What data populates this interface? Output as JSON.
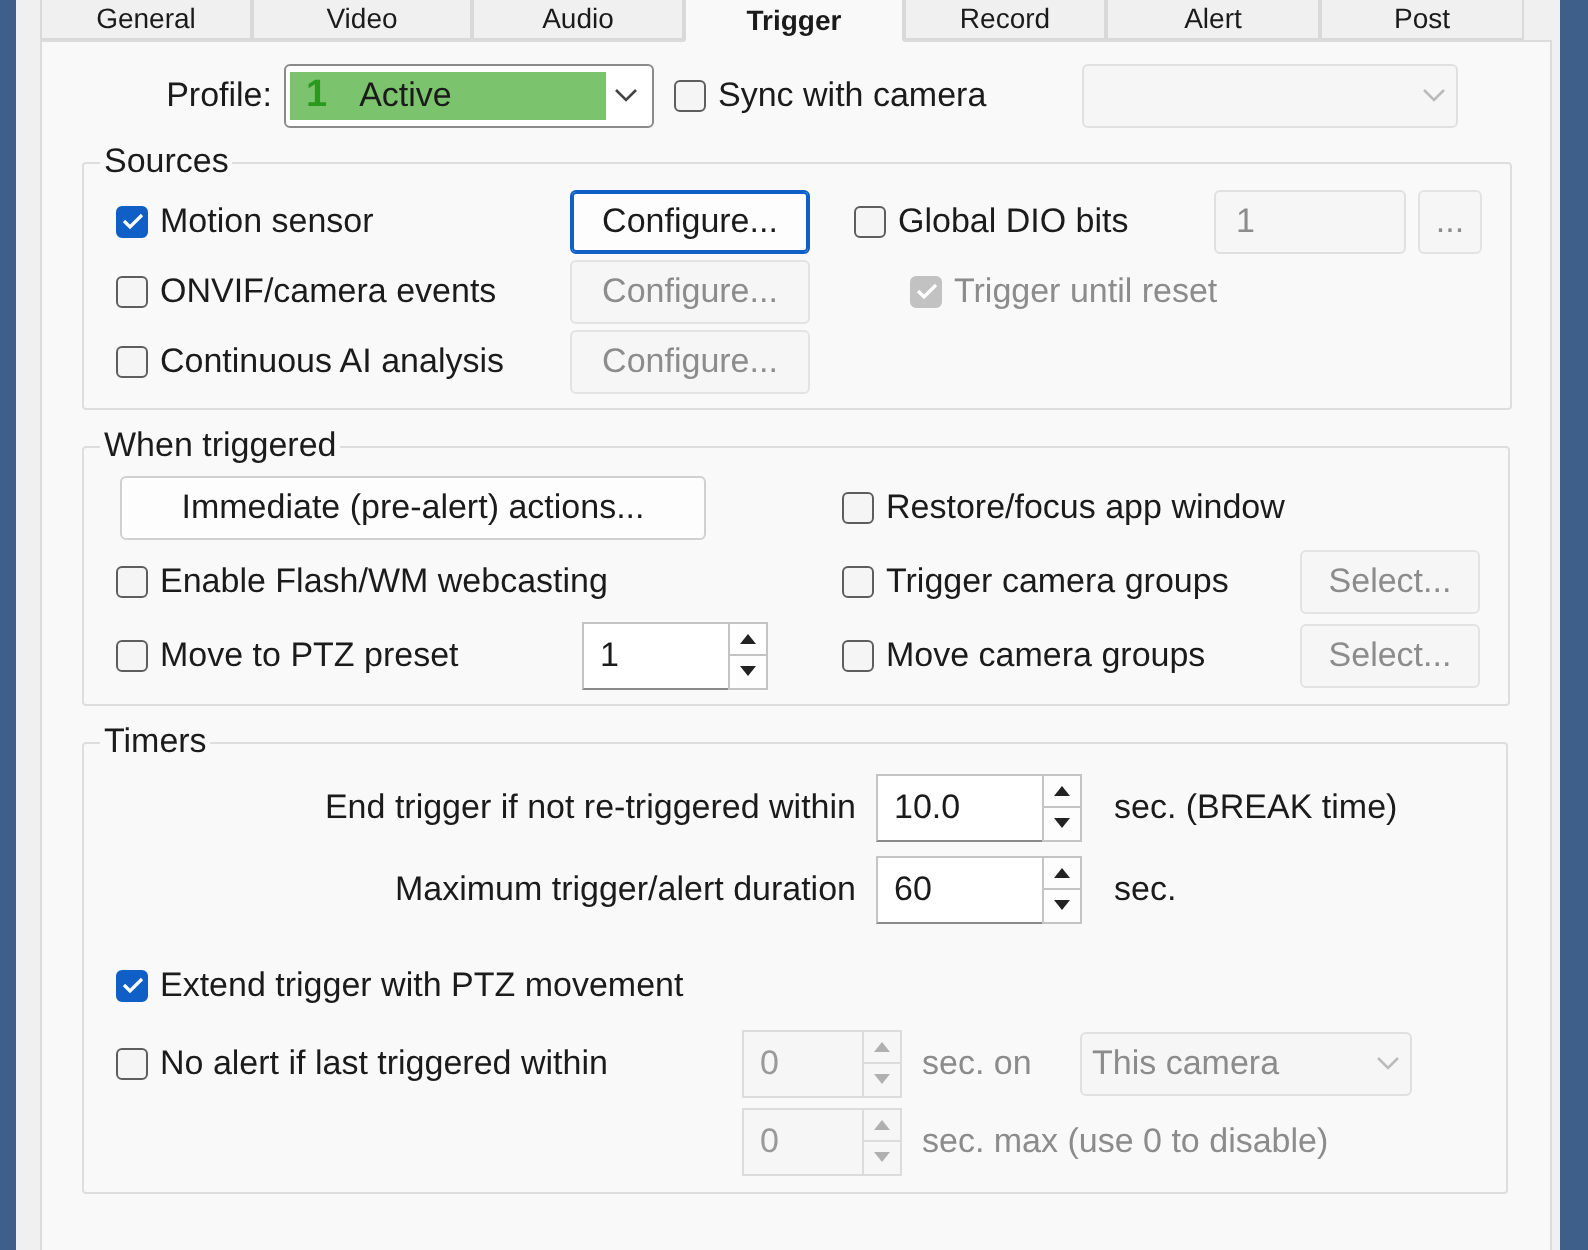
{
  "tabs": [
    {
      "label": "General",
      "selected": false
    },
    {
      "label": "Video",
      "selected": false
    },
    {
      "label": "Audio",
      "selected": false
    },
    {
      "label": "Trigger",
      "selected": true
    },
    {
      "label": "Record",
      "selected": false
    },
    {
      "label": "Alert",
      "selected": false
    },
    {
      "label": "Post",
      "selected": false
    }
  ],
  "profile": {
    "label": "Profile:",
    "number": "1",
    "value": "Active"
  },
  "sync": {
    "label": "Sync with camera",
    "checked": false
  },
  "sources": {
    "title": "Sources",
    "items": [
      {
        "label": "Motion sensor",
        "checked": true,
        "button": "Configure...",
        "disabled": false
      },
      {
        "label": "ONVIF/camera events",
        "checked": false,
        "button": "Configure...",
        "disabled": true
      },
      {
        "label": "Continuous AI analysis",
        "checked": false,
        "button": "Configure...",
        "disabled": true
      }
    ],
    "dio": {
      "label": "Global DIO bits",
      "checked": false,
      "value": "1",
      "button": "..."
    },
    "until_reset": {
      "label": "Trigger until reset",
      "checked": true,
      "disabled": true
    }
  },
  "when_triggered": {
    "title": "When triggered",
    "actions_button": "Immediate (pre-alert) actions...",
    "restore": {
      "label": "Restore/focus app window",
      "checked": false
    },
    "flash": {
      "label": "Enable Flash/WM webcasting",
      "checked": false
    },
    "ptz": {
      "label": "Move to PTZ preset",
      "checked": false,
      "value": "1"
    },
    "groups": [
      {
        "label": "Trigger camera groups",
        "checked": false,
        "button": "Select...",
        "disabled": true
      },
      {
        "label": "Move camera groups",
        "checked": false,
        "button": "Select...",
        "disabled": true
      }
    ]
  },
  "timers": {
    "title": "Timers",
    "durations": [
      {
        "label": "End trigger if not re-triggered within",
        "value": "10.0",
        "unit": "sec. (BREAK time)"
      },
      {
        "label": "Maximum trigger/alert duration",
        "value": "60",
        "unit": "sec."
      }
    ],
    "extend": {
      "label": "Extend trigger with PTZ movement",
      "checked": true
    },
    "no_alert": {
      "label": "No alert if last triggered within",
      "checked": false,
      "value": "0",
      "unit": "sec. on",
      "scope": "This camera",
      "disabled": true
    },
    "max_alerts": {
      "value": "0",
      "unit": "sec. max (use 0 to disable)",
      "disabled": true
    }
  }
}
